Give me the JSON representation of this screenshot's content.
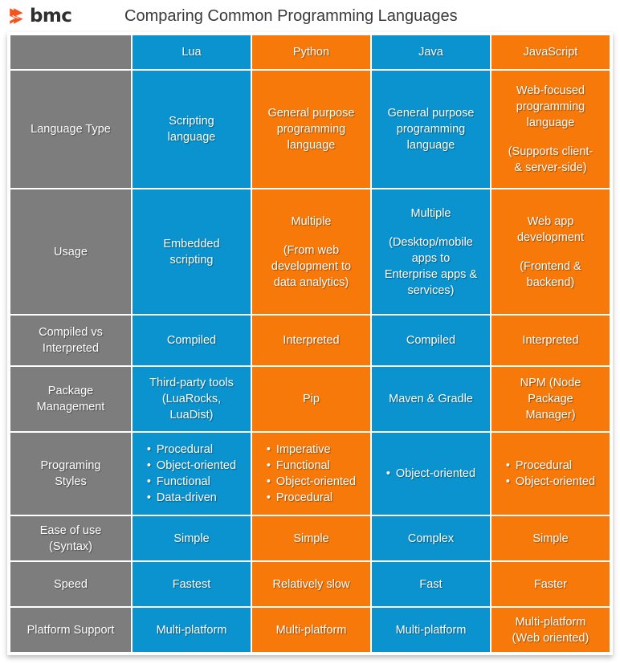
{
  "header": {
    "logo_text": "bmc",
    "logo_icon": "bmc-bowtie-logo",
    "title": "Comparing Common Programming Languages"
  },
  "table": {
    "corner_label": "",
    "columns": [
      "Lua",
      "Python",
      "Java",
      "JavaScript"
    ],
    "colors": {
      "gray": "#7d7d7d",
      "blue": "#0b93cf",
      "orange": "#f7790a",
      "text": "#ffffff",
      "title": "#3a3a3a",
      "logo_orange": "#f4541d"
    },
    "rows": [
      {
        "label": "Language Type",
        "cells": [
          {
            "lines": [
              "Scripting\nlanguage"
            ]
          },
          {
            "lines": [
              "General purpose\nprogramming\nlanguage"
            ]
          },
          {
            "lines": [
              "General purpose\nprogramming\nlanguage"
            ]
          },
          {
            "lines": [
              "Web-focused\nprogramming\nlanguage",
              "(Supports client-\n& server-side)"
            ]
          }
        ]
      },
      {
        "label": "Usage",
        "cells": [
          {
            "lines": [
              "Embedded\nscripting"
            ]
          },
          {
            "lines": [
              "Multiple",
              "(From web\ndevelopment to\ndata analytics)"
            ]
          },
          {
            "lines": [
              "Multiple",
              "(Desktop/mobile\napps to\nEnterprise apps &\nservices)"
            ]
          },
          {
            "lines": [
              "Web app\ndevelopment",
              "(Frontend &\nbackend)"
            ]
          }
        ]
      },
      {
        "label": "Compiled vs\nInterpreted",
        "cells": [
          {
            "lines": [
              "Compiled"
            ]
          },
          {
            "lines": [
              "Interpreted"
            ]
          },
          {
            "lines": [
              "Compiled"
            ]
          },
          {
            "lines": [
              "Interpreted"
            ]
          }
        ]
      },
      {
        "label": "Package\nManagement",
        "cells": [
          {
            "lines": [
              "Third-party tools\n(LuaRocks,\nLuaDist)"
            ]
          },
          {
            "lines": [
              "Pip"
            ]
          },
          {
            "lines": [
              "Maven & Gradle"
            ]
          },
          {
            "lines": [
              "NPM (Node\nPackage\nManager)"
            ]
          }
        ]
      },
      {
        "label": "Programing\nStyles",
        "bullets": [
          [
            "Procedural",
            "Object-oriented",
            "Functional",
            "Data-driven"
          ],
          [
            "Imperative",
            "Functional",
            "Object-oriented",
            "Procedural"
          ],
          [
            "Object-oriented"
          ],
          [
            "Procedural",
            "Object-oriented"
          ]
        ]
      },
      {
        "label": "Ease of use\n(Syntax)",
        "cells": [
          {
            "lines": [
              "Simple"
            ]
          },
          {
            "lines": [
              "Simple"
            ]
          },
          {
            "lines": [
              "Complex"
            ]
          },
          {
            "lines": [
              "Simple"
            ]
          }
        ]
      },
      {
        "label": "Speed",
        "cells": [
          {
            "lines": [
              "Fastest"
            ]
          },
          {
            "lines": [
              "Relatively slow"
            ]
          },
          {
            "lines": [
              "Fast"
            ]
          },
          {
            "lines": [
              "Faster"
            ]
          }
        ]
      },
      {
        "label": "Platform Support",
        "cells": [
          {
            "lines": [
              "Multi-platform"
            ]
          },
          {
            "lines": [
              "Multi-platform"
            ]
          },
          {
            "lines": [
              "Multi-platform"
            ]
          },
          {
            "lines": [
              "Multi-platform\n(Web oriented)"
            ]
          }
        ]
      }
    ]
  }
}
